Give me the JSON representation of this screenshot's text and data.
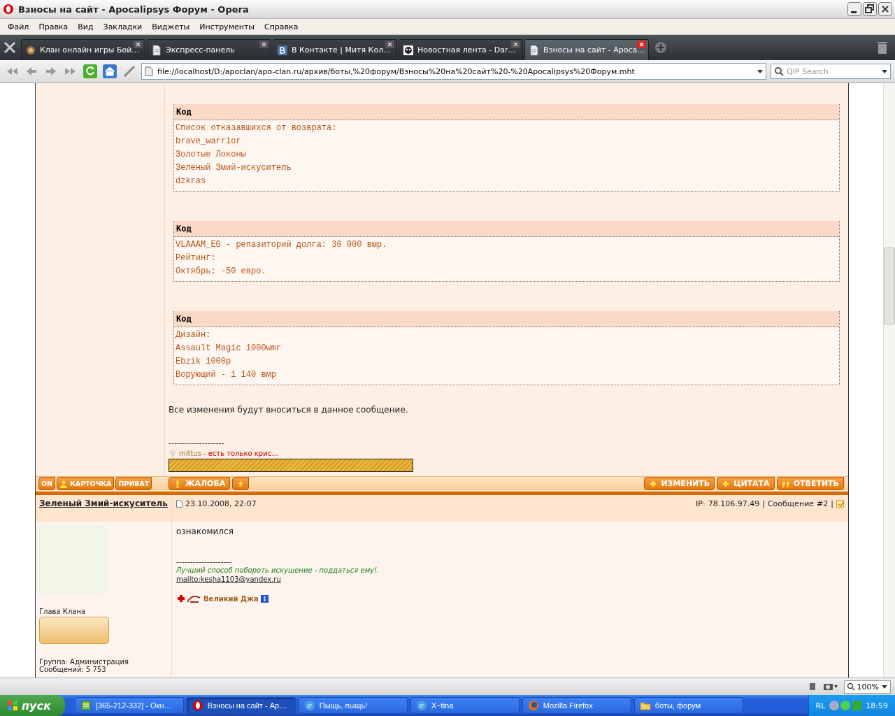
{
  "window": {
    "title": "Взносы на сайт - Apocalipsys Форум - Opera"
  },
  "menu": [
    "Файл",
    "Правка",
    "Вид",
    "Закладки",
    "Виджеты",
    "Инструменты",
    "Справка"
  ],
  "tabs": [
    {
      "label": "Клан онлайн игры Бой…",
      "kind": "clan",
      "selected": false
    },
    {
      "label": "Экспресс-панель",
      "kind": "page",
      "selected": false
    },
    {
      "label": "В Контакте | Митя Кол…",
      "kind": "vk",
      "selected": false
    },
    {
      "label": "Новостная лента - Dar…",
      "kind": "news",
      "selected": false
    },
    {
      "label": "Взносы на сайт - Apoca…",
      "kind": "page",
      "selected": true
    }
  ],
  "address": {
    "url": "file://localhost/D:/apoclan/apo-clan.ru/архив/боты,%20форум/Взносы%20на%20сайт%20-%20Apocalipsys%20Форум.mht",
    "search_placeholder": "QIP Search"
  },
  "post1": {
    "code_blocks": [
      {
        "title": "Код",
        "lines": [
          "Список отказавшихся от возврата:",
          "brave_warrior",
          "Золотые Локоны",
          "Зеленый Змий-искуситель",
          "dzkras"
        ]
      },
      {
        "title": "Код",
        "lines": [
          "VLAAAM_EG - репазиторий долга: 30 000 вмр.",
          "Рейтинг:",
          "Октябрь: -50 евро."
        ]
      },
      {
        "title": "Код",
        "lines": [
          "Дизайн:",
          "Assault Magic 1000wmr",
          "Ebzik 1000р",
          "Ворующий - 1 140 вмр"
        ]
      }
    ],
    "message": "Все изменения будут вноситься в данное сообщение.",
    "signature_rule": "--------------------",
    "signature_user": "mittus",
    "signature_status": "- есть только крис...",
    "left_buttons": [
      {
        "label": "ON",
        "kind": "plain"
      },
      {
        "label": "КАРТОЧКА",
        "kind": "person"
      },
      {
        "label": "ПРИВАТ",
        "kind": "plain"
      }
    ],
    "middle_buttons": [
      {
        "label": "ЖАЛОБА",
        "kind": "alert"
      }
    ],
    "right_buttons": [
      {
        "label": "ИЗМЕНИТЬ",
        "kind": "plus"
      },
      {
        "label": "ЦИТАТА",
        "kind": "plus"
      },
      {
        "label": "ОТВЕТИТЬ",
        "kind": "quote"
      }
    ]
  },
  "post2": {
    "author": "Зеленый Змий-искуситель",
    "date": "23.10.2008, 22:07",
    "ip_label": "IP:",
    "ip": "78.106.97.49",
    "sep": "|",
    "message_label": "Сообщение",
    "message_link": "#2",
    "sep2": "|",
    "selected": true,
    "rank": "Глава Клана",
    "group": "Группа: Администрация",
    "posts": "Сообщений: 5 753",
    "body": "ознакомился",
    "signature_rule": "--------------------",
    "signature_quote": "Лучший способ побороть искушение - поддаться ему!.",
    "signature_mail": "mailto:kesha1103@yandex.ru",
    "award": "Великий Джа"
  },
  "status": {
    "zoom": "100%"
  },
  "taskbar": {
    "start": "пуск",
    "items": [
      {
        "label": "[365-212-332] - Окн…",
        "kind": "qip",
        "selected": false
      },
      {
        "label": "Взносы на сайт - Ap…",
        "kind": "opera",
        "selected": true
      },
      {
        "label": "Пыщь, пыщь!",
        "kind": "chat",
        "selected": false
      },
      {
        "label": "X~tina",
        "kind": "chat",
        "selected": false
      },
      {
        "label": "Mozilla Firefox",
        "kind": "firefox",
        "selected": false
      },
      {
        "label": "боты, форум",
        "kind": "folder",
        "selected": false
      }
    ],
    "lang": "RL",
    "clock": "18:59"
  }
}
